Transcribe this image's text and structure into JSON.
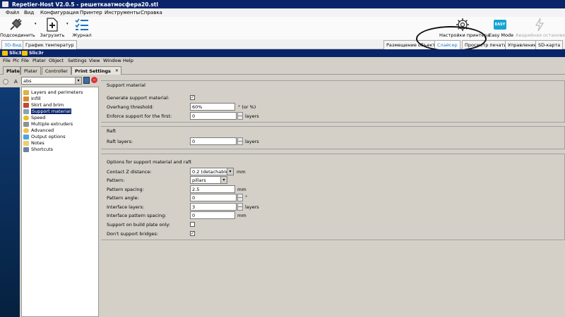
{
  "window": {
    "title": "Repetier-Host V2.0.5 - решеткаатмосфера20.stl"
  },
  "menu": [
    "Файл",
    "Вид",
    "Конфигурация",
    "Принтер",
    "Инструменты",
    "Справка"
  ],
  "toolbar": {
    "connect": "Подсоединить",
    "load": "Загрузить",
    "log": "Журнал",
    "printer_settings": "Настройки принтера",
    "easy_mode": "Easy Mode",
    "easy_badge": "EASY",
    "emergency": "Аварийная остановка"
  },
  "main_tabs": {
    "view3d": "3D-Вид",
    "temp_graph": "График температур"
  },
  "right_tabs": [
    "Размещение объекта",
    "Слайсер",
    "Просмотр печати",
    "Управление",
    "SD-карта"
  ],
  "window_tabs": [
    "Slic3",
    "Slic3r"
  ],
  "slic_menu": [
    "File",
    "Plc",
    "File",
    "Plater",
    "Object",
    "Settings",
    "View",
    "Window",
    "Help"
  ],
  "slic_tabs": {
    "plater_cut": "Plater",
    "plater": "Plater",
    "controller": "Controller",
    "print_settings": "Print Settings",
    "close": "✕"
  },
  "left_letter": "A",
  "preset": {
    "value": "abs"
  },
  "tree": [
    {
      "label": "Layers and perimeters",
      "color": "#e0b040"
    },
    {
      "label": "Infill",
      "color": "#d88a30"
    },
    {
      "label": "Skirt and brim",
      "color": "#c04a30"
    },
    {
      "label": "Support material",
      "color": "#8aa0c0"
    },
    {
      "label": "Speed",
      "color": "#e0c020"
    },
    {
      "label": "Multiple extruders",
      "color": "#909090"
    },
    {
      "label": "Advanced",
      "color": "#f0c040"
    },
    {
      "label": "Output options",
      "color": "#50a0e0"
    },
    {
      "label": "Notes",
      "color": "#e8d070"
    },
    {
      "label": "Shortcuts",
      "color": "#7080a0"
    }
  ],
  "support": {
    "group_title": "Support material",
    "generate_label": "Generate support material:",
    "generate_checked": "✓",
    "overhang_label": "Overhang threshold:",
    "overhang_value": "60%",
    "overhang_unit": "° (or %)",
    "enforce_label": "Enforce support for the first:",
    "enforce_value": "0",
    "enforce_unit": "layers"
  },
  "raft": {
    "group_title": "Raft",
    "layers_label": "Raft layers:",
    "layers_value": "0",
    "layers_unit": "layers"
  },
  "options": {
    "group_title": "Options for support material and raft",
    "contact_label": "Contact Z distance:",
    "contact_value": "0.2 (detachable)",
    "contact_unit": "mm",
    "pattern_label": "Pattern:",
    "pattern_value": "pillars",
    "spacing_label": "Pattern spacing:",
    "spacing_value": "2.5",
    "spacing_unit": "mm",
    "angle_label": "Pattern angle:",
    "angle_value": "0",
    "angle_unit": "°",
    "interface_label": "Interface layers:",
    "interface_value": "3",
    "interface_unit": "layers",
    "interface_spacing_label": "Interface pattern spacing:",
    "interface_spacing_value": "0",
    "interface_spacing_unit": "mm",
    "buildplate_label": "Support on build plate only:",
    "bridges_label": "Don't support bridges:",
    "bridges_checked": "✓"
  }
}
